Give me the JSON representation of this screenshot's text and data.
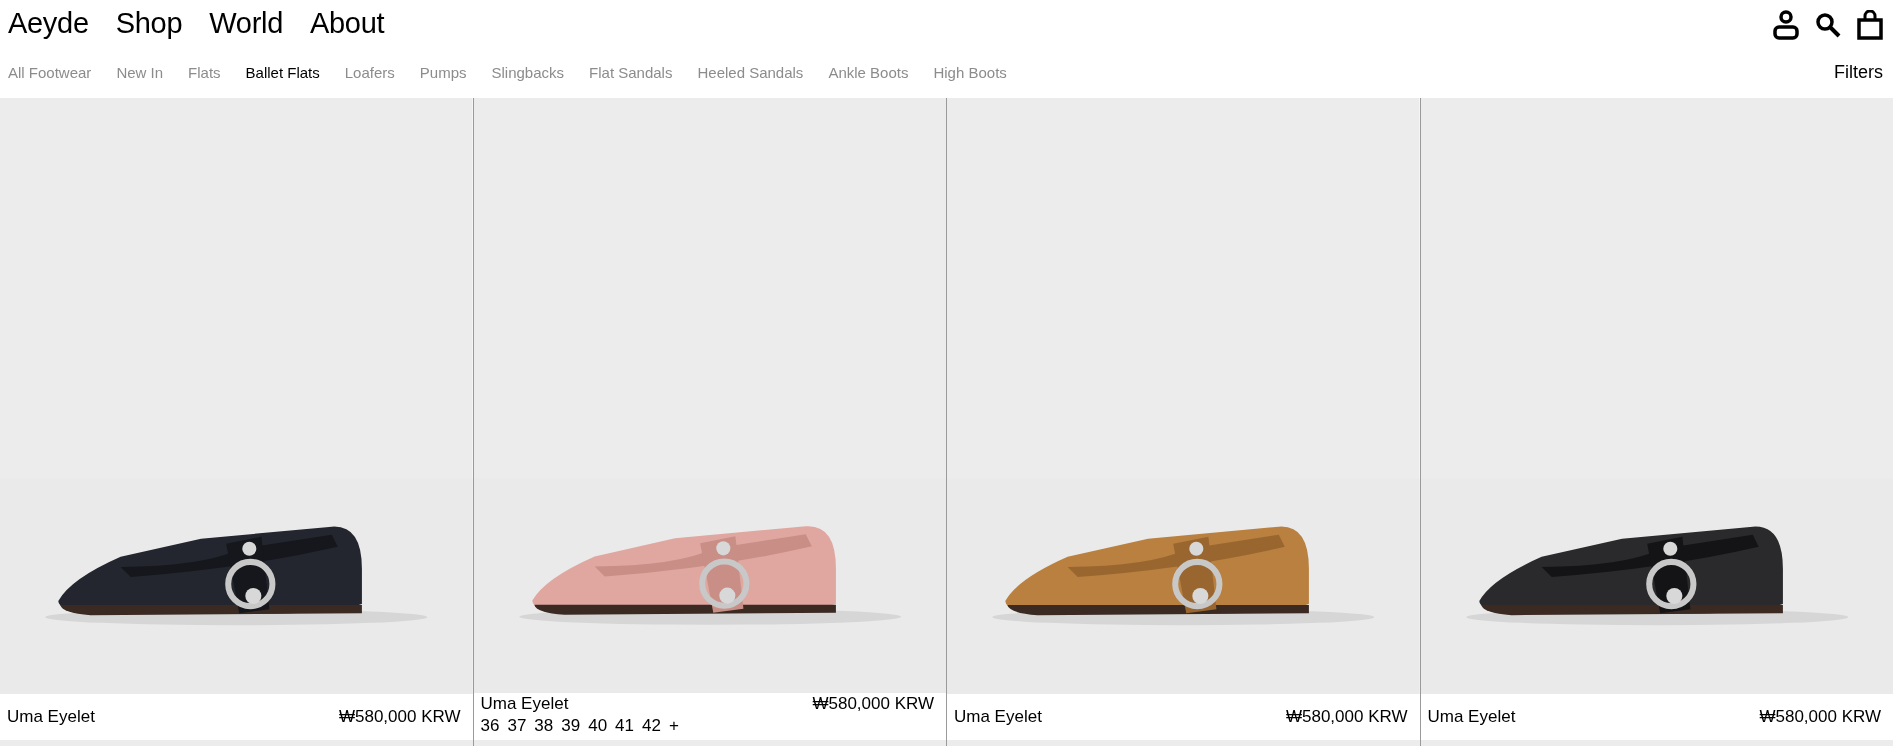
{
  "header": {
    "nav": [
      "Aeyde",
      "Shop",
      "World",
      "About"
    ]
  },
  "categories": [
    {
      "label": "All Footwear",
      "selected": false
    },
    {
      "label": "New In",
      "selected": false
    },
    {
      "label": "Flats",
      "selected": false
    },
    {
      "label": "Ballet Flats",
      "selected": true
    },
    {
      "label": "Loafers",
      "selected": false
    },
    {
      "label": "Pumps",
      "selected": false
    },
    {
      "label": "Slingbacks",
      "selected": false
    },
    {
      "label": "Flat Sandals",
      "selected": false
    },
    {
      "label": "Heeled Sandals",
      "selected": false
    },
    {
      "label": "Ankle Boots",
      "selected": false
    },
    {
      "label": "High Boots",
      "selected": false
    }
  ],
  "filters": "Filters",
  "products": [
    {
      "name": "Uma Eyelet",
      "price": "₩580,000 KRW"
    },
    {
      "name": "Uma Eyelet",
      "price": "₩580,000 KRW",
      "sizes": [
        "36",
        "37",
        "38",
        "39",
        "40",
        "41",
        "42",
        "+"
      ]
    },
    {
      "name": "Uma Eyelet",
      "price": "₩580,000 KRW"
    },
    {
      "name": "Uma Eyelet",
      "price": "₩580,000 KRW"
    }
  ]
}
